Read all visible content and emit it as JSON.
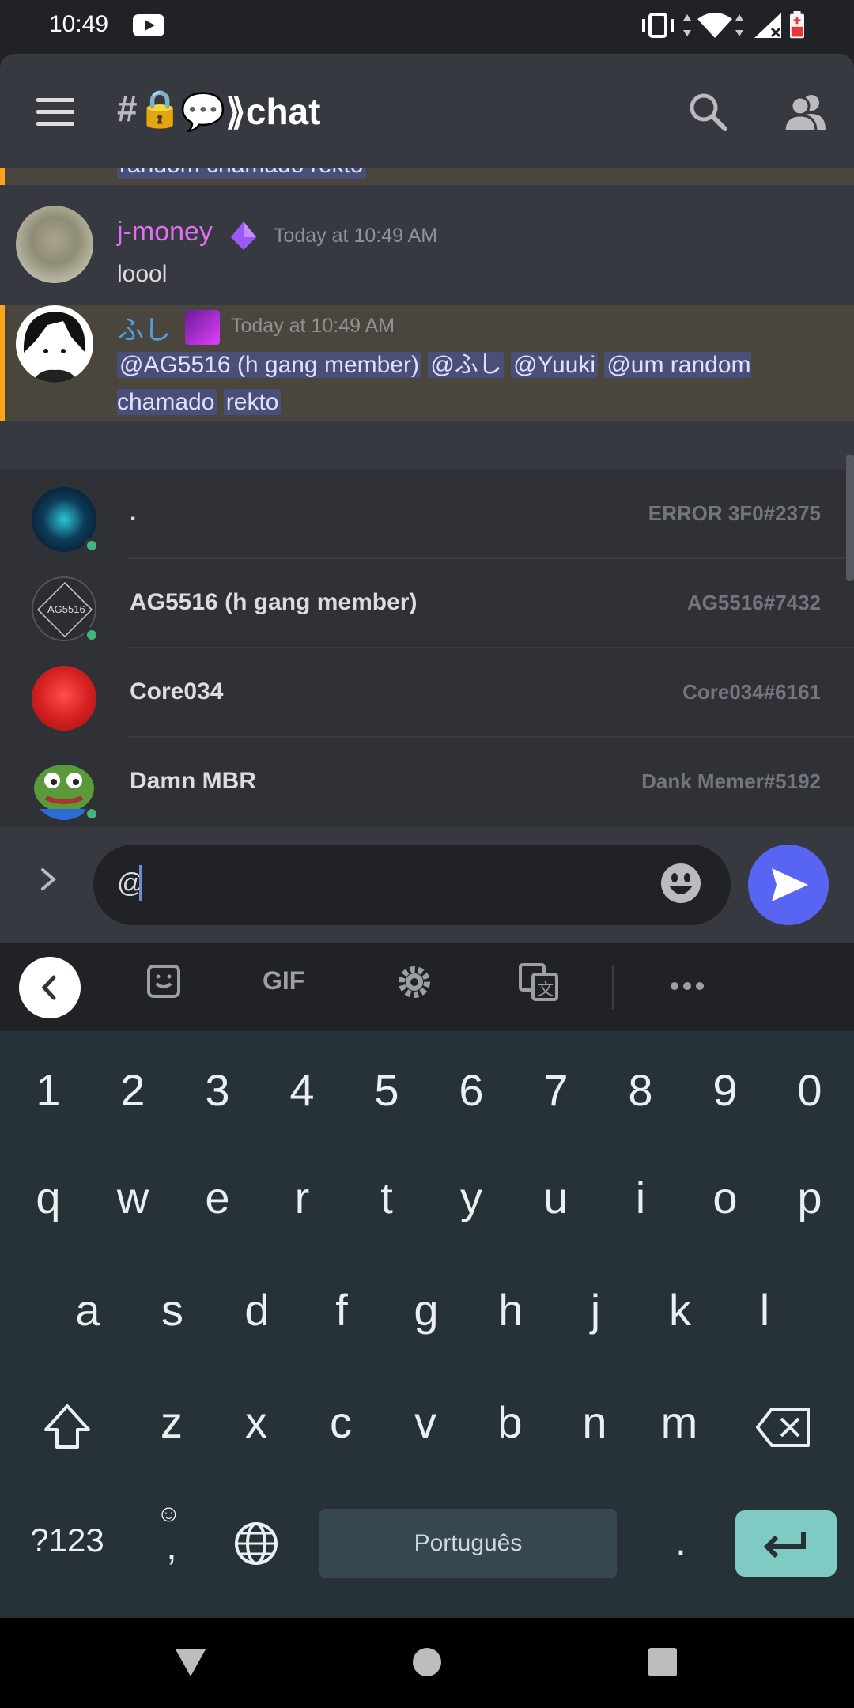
{
  "status_bar": {
    "time": "10:49"
  },
  "header": {
    "channel_icon": "#🔒",
    "channel_name": "💬⟫chat"
  },
  "messages": {
    "previous_fragment": "random chamado rekto",
    "items": [
      {
        "author": "j-money",
        "author_color": "#e26ff0",
        "badge": "purple-diamond-icon",
        "timestamp": "Today at 10:49 AM",
        "text": "loool"
      },
      {
        "author": "ふし",
        "author_color": "#4f9ede",
        "timestamp": "Today at 10:49 AM",
        "mentions": [
          "@AG5516 (h gang member)",
          "@ふし",
          "@Yuuki",
          "@um random chamado",
          "rekto"
        ]
      }
    ]
  },
  "mention_popup": {
    "rows": [
      {
        "name": ".",
        "tag": "ERROR 3F0#2375",
        "online": true
      },
      {
        "name": "AG5516 (h gang member)",
        "tag": "AG5516#7432",
        "online": true,
        "avatar_text": "AG5516"
      },
      {
        "name": "Core034",
        "tag": "Core034#6161",
        "online": false
      },
      {
        "name": "Damn MBR",
        "tag": "Dank Memer#5192",
        "online": true
      }
    ]
  },
  "composer": {
    "value": "@"
  },
  "keyboard_toolbar": {
    "gif_label": "GIF"
  },
  "keyboard": {
    "numbers": [
      "1",
      "2",
      "3",
      "4",
      "5",
      "6",
      "7",
      "8",
      "9",
      "0"
    ],
    "row1": [
      "q",
      "w",
      "e",
      "r",
      "t",
      "y",
      "u",
      "i",
      "o",
      "p"
    ],
    "row2": [
      "a",
      "s",
      "d",
      "f",
      "g",
      "h",
      "j",
      "k",
      "l"
    ],
    "row3": [
      "z",
      "x",
      "c",
      "v",
      "b",
      "n",
      "m"
    ],
    "symbols_label": "?123",
    "comma_label": ",",
    "period_label": ".",
    "space_label": "Português"
  },
  "colors": {
    "accent": "#5865f2",
    "mention_bg": "#4a4f7a",
    "highlight_border": "#faa61a",
    "enter_key": "#7fcbc4"
  }
}
